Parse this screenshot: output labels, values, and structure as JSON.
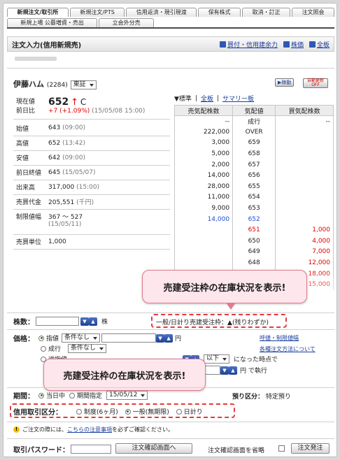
{
  "tabs_row1": [
    "新規注文/取引所",
    "新規注文/PTS",
    "信用返済・現引現渡",
    "保有株式",
    "取消・訂正",
    "注文照会"
  ],
  "tabs_row2": [
    "新規上場 公募増資・売出",
    "立会外分売"
  ],
  "header": {
    "title": "注文入力(信用新規売)",
    "link_buying_power": "買付・信用建余力",
    "link_stock_price": "株価",
    "link_full": "全板"
  },
  "stock": {
    "name": "伊藤ハム",
    "code": "(2284)",
    "market": "東証",
    "btn_auto": "▶稼動",
    "btn_autoupdate": "自動更新OFF"
  },
  "quote": {
    "current_label": "現在値",
    "current_value": "652",
    "current_arrow": "↑",
    "current_flag": "C",
    "change_label": "前日比",
    "change_value": "+7 (+1.09%)",
    "change_time": "(15/05/08 15:00)",
    "rows": [
      {
        "label": "始値",
        "value": "643",
        "time": "(09:00)"
      },
      {
        "label": "高値",
        "value": "652",
        "time": "(13:42)"
      },
      {
        "label": "安値",
        "value": "642",
        "time": "(09:00)"
      },
      {
        "label": "前日終値",
        "value": "645",
        "time": "(15/05/07)"
      },
      {
        "label": "出来高",
        "value": "317,000",
        "time": "(15:00)"
      },
      {
        "label": "売買代金",
        "value": "205,551",
        "time": "(千円)"
      }
    ],
    "limit_label": "制限値幅",
    "limit_value": "367 ～ 527",
    "limit_date": "(15/05/11)",
    "unit_label": "売買単位",
    "unit_value": "1,000"
  },
  "orders": {
    "view_standard": "▼標準",
    "view_full": "全板",
    "view_summary": "サマリー板",
    "headers": [
      "売気配株数",
      "気配値",
      "買気配株数"
    ],
    "rows": [
      {
        "sell": "--",
        "price": "成行",
        "buy": "--"
      },
      {
        "sell": "222,000",
        "price": "OVER",
        "buy": ""
      },
      {
        "sell": "3,000",
        "price": "659",
        "buy": ""
      },
      {
        "sell": "5,000",
        "price": "658",
        "buy": ""
      },
      {
        "sell": "2,000",
        "price": "657",
        "buy": ""
      },
      {
        "sell": "14,000",
        "price": "656",
        "buy": ""
      },
      {
        "sell": "28,000",
        "price": "655",
        "buy": ""
      },
      {
        "sell": "11,000",
        "price": "654",
        "buy": ""
      },
      {
        "sell": "9,000",
        "price": "653",
        "buy": ""
      },
      {
        "sell": "14,000",
        "price": "652",
        "buy": ""
      },
      {
        "sell": "",
        "price": "651",
        "buy": "1,000"
      },
      {
        "sell": "",
        "price": "650",
        "buy": "4,000"
      },
      {
        "sell": "",
        "price": "649",
        "buy": "7,000"
      },
      {
        "sell": "",
        "price": "648",
        "buy": "12,000"
      },
      {
        "sell": "",
        "price": "647",
        "buy": "18,000"
      },
      {
        "sell": "",
        "price": "646",
        "buy": "15,000"
      }
    ]
  },
  "callout1": "売建受注枠の在庫状況を表示!",
  "callout2": "売建受注枠の在庫状況を表示!",
  "quota": {
    "text": "一般/日計り売建受注枠：▲(残りわずか)"
  },
  "form": {
    "qty_label": "株数：",
    "qty_unit": "株",
    "price_label": "価格：",
    "opt_limit": "指値",
    "opt_market": "成行",
    "opt_reverse": "逆指値",
    "cond": "条件なし",
    "yen": "円",
    "link_limit": "呼値・制限値幅",
    "link_types": "各種注文方法について",
    "below": "以下",
    "trigger_text": "になった時点で",
    "exec_text": "円 で執行",
    "period_label": "期間：",
    "period_today": "当日中",
    "period_date": "期間指定",
    "period_val": "15/05/12",
    "deposit_label": "預り区分：",
    "deposit_value": "特定預り",
    "margin_label": "信用取引区分：",
    "margin_system": "制度(6ヶ月)",
    "margin_general": "一般(無期限)",
    "margin_day": "日計り",
    "notice_pre": "ご注文の際には、",
    "notice_link": "こちらの注意事項",
    "notice_post": "を必ずご確認ください。",
    "password_label": "取引パスワード：",
    "confirm_btn": "注文確認画面へ",
    "skip_label": "注文確認画面を省略",
    "submit_btn": "注文発注"
  },
  "colors": {
    "red": "#e00000",
    "blue": "#1f4fd6",
    "callout_bg": "#fde7ec",
    "dash": "#e43a3a"
  }
}
